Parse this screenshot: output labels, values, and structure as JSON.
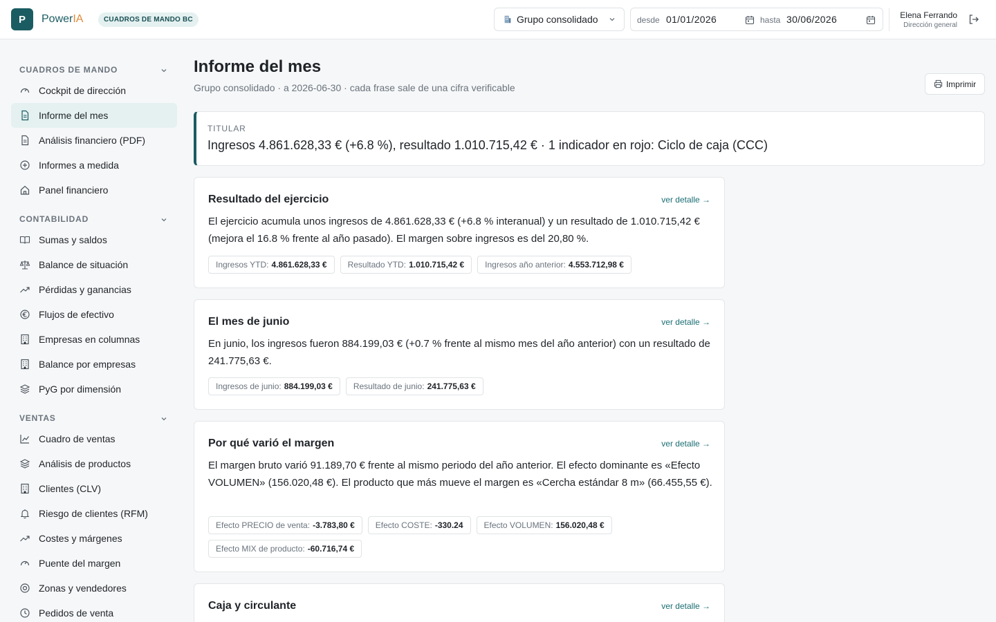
{
  "header": {
    "logo_letter": "P",
    "brand_prefix": "Power",
    "brand_suffix": "IA",
    "badge": "CUADROS DE MANDO BC",
    "company": "Grupo consolidado",
    "date_from_label": "desde",
    "date_from": "01/01/2026",
    "date_to_label": "hasta",
    "date_to": "30/06/2026",
    "user_name": "Elena Ferrando",
    "user_role": "Dirección general"
  },
  "sidebar": {
    "sections": [
      {
        "title": "CUADROS DE MANDO",
        "items": [
          {
            "label": "Cockpit de dirección",
            "icon": "gauge-icon"
          },
          {
            "label": "Informe del mes",
            "icon": "document-icon",
            "active": true
          },
          {
            "label": "Análisis financiero (PDF)",
            "icon": "document-icon"
          },
          {
            "label": "Informes a medida",
            "icon": "plus-circle-icon"
          },
          {
            "label": "Panel financiero",
            "icon": "home-icon"
          }
        ]
      },
      {
        "title": "CONTABILIDAD",
        "items": [
          {
            "label": "Sumas y saldos",
            "icon": "book-icon"
          },
          {
            "label": "Balance de situación",
            "icon": "scale-icon"
          },
          {
            "label": "Pérdidas y ganancias",
            "icon": "trend-icon"
          },
          {
            "label": "Flujos de efectivo",
            "icon": "euro-icon"
          },
          {
            "label": "Empresas en columnas",
            "icon": "building-icon"
          },
          {
            "label": "Balance por empresas",
            "icon": "building-icon"
          },
          {
            "label": "PyG por dimensión",
            "icon": "layers-icon"
          }
        ]
      },
      {
        "title": "VENTAS",
        "items": [
          {
            "label": "Cuadro de ventas",
            "icon": "line-chart-icon"
          },
          {
            "label": "Análisis de productos",
            "icon": "layers-icon"
          },
          {
            "label": "Clientes (CLV)",
            "icon": "building-icon"
          },
          {
            "label": "Riesgo de clientes (RFM)",
            "icon": "bell-icon"
          },
          {
            "label": "Costes y márgenes",
            "icon": "trend-icon"
          },
          {
            "label": "Puente del margen",
            "icon": "gauge-icon"
          },
          {
            "label": "Zonas y vendedores",
            "icon": "target-icon"
          },
          {
            "label": "Pedidos de venta",
            "icon": "clock-icon"
          }
        ]
      }
    ]
  },
  "main": {
    "title": "Informe del mes",
    "subtitle": "Grupo consolidado · a 2026-06-30 · cada frase sale de una cifra verificable",
    "print_label": "Imprimir",
    "headline_label": "TITULAR",
    "headline_text": "Ingresos 4.861.628,33 € (+6.8 %), resultado 1.010.715,42 € · 1 indicador en rojo: Ciclo de caja (CCC)",
    "cards": [
      {
        "title": "Resultado del ejercicio",
        "link": "ver detalle →",
        "body": "El ejercicio acumula unos ingresos de 4.861.628,33 € (+6.8 % interanual) y un resultado de 1.010.715,42 € (mejora el 16.8 % frente al año pasado). El margen sobre ingresos es del 20,80 %.",
        "chips": [
          {
            "k": "Ingresos YTD:",
            "v": "4.861.628,33 €"
          },
          {
            "k": "Resultado YTD:",
            "v": "1.010.715,42 €"
          },
          {
            "k": "Ingresos año anterior:",
            "v": "4.553.712,98 €"
          }
        ]
      },
      {
        "title": "El mes de junio",
        "link": "ver detalle →",
        "body": "En junio, los ingresos fueron 884.199,03 € (+0.7 % frente al mismo mes del año anterior) con un resultado de 241.775,63 €.",
        "chips": [
          {
            "k": "Ingresos de junio:",
            "v": "884.199,03 €"
          },
          {
            "k": "Resultado de junio:",
            "v": "241.775,63 €"
          }
        ]
      },
      {
        "title": "Por qué varió el margen",
        "link": "ver detalle →",
        "body": "El margen bruto varió 91.189,70 € frente al mismo periodo del año anterior. El efecto dominante es «Efecto VOLUMEN» (156.020,48 €). El producto que más mueve el margen es «Cercha estándar 8 m» (66.455,55 €).",
        "chips": [
          {
            "k": "Efecto PRECIO de venta:",
            "v": "-3.783,80 €"
          },
          {
            "k": "Efecto COSTE:",
            "v": "-330.24"
          },
          {
            "k": "Efecto VOLUMEN:",
            "v": "156.020,48 €"
          },
          {
            "k": "Efecto MIX de producto:",
            "v": "-60.716,74 €"
          }
        ]
      },
      {
        "title": "Caja y circulante",
        "link": "ver detalle →",
        "body": "",
        "chips": []
      }
    ]
  }
}
